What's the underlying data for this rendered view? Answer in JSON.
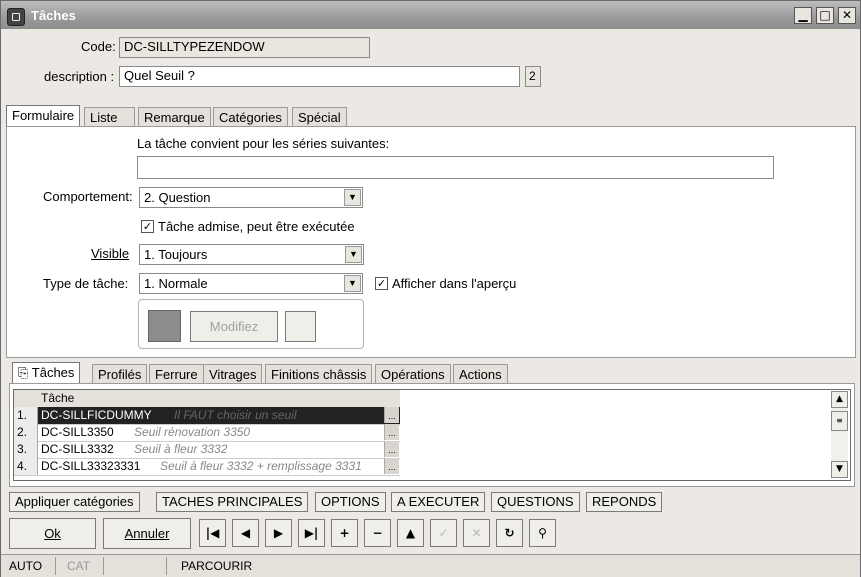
{
  "window": {
    "title": "Tâches",
    "minimize": "▁",
    "maximize": "□",
    "close": "✕"
  },
  "form": {
    "code_label": "Code:",
    "code_value": "DC-SILLTYPEZENDOW",
    "description_label": "description :",
    "description_value": "Quel Seuil ?",
    "description_counter": "2"
  },
  "tabs": [
    "Formulaire",
    "Liste",
    "Remarque",
    "Catégories",
    "Spécial"
  ],
  "formulaire": {
    "series_label": "La tâche convient pour les séries suivantes:",
    "series_value": "",
    "comportement_label": "Comportement:",
    "comportement_value": "2.  Question",
    "admise_label": "Tâche admise, peut être exécutée",
    "visible_label": "Visible",
    "visible_value": "1.  Toujours",
    "type_label": "Type de tâche:",
    "type_value": "1.  Normale",
    "apercu_label": "Afficher dans l'aperçu",
    "modifiez_label": "Modifiez",
    "color_swatch": "#8c8c8c"
  },
  "subtabs": [
    "Tâches",
    "Profilés",
    "Ferrure",
    "Vitrages",
    "Finitions châssis",
    "Opérations",
    "Actions"
  ],
  "grid": {
    "header": "Tâche",
    "rows": [
      {
        "num": "1.",
        "code": "DC-SILLFICDUMMY",
        "desc": "Il FAUT choisir un seuil"
      },
      {
        "num": "2.",
        "code": "DC-SILL3350",
        "desc": "Seuil rénovation 3350"
      },
      {
        "num": "3.",
        "code": "DC-SILL3332",
        "desc": "Seuil à fleur 3332"
      },
      {
        "num": "4.",
        "code": "DC-SILL33323331",
        "desc": "Seuil à fleur 3332 + remplissage 3331"
      }
    ]
  },
  "command_buttons": [
    "Appliquer catégories",
    "TACHES PRINCIPALES",
    "OPTIONS",
    "A EXECUTER",
    "QUESTIONS",
    "REPONDS"
  ],
  "actions": {
    "ok": "Ok",
    "cancel": "Annuler"
  },
  "status": {
    "mode1": "AUTO",
    "mode2": "CAT",
    "mode3": "PARCOURIR"
  }
}
